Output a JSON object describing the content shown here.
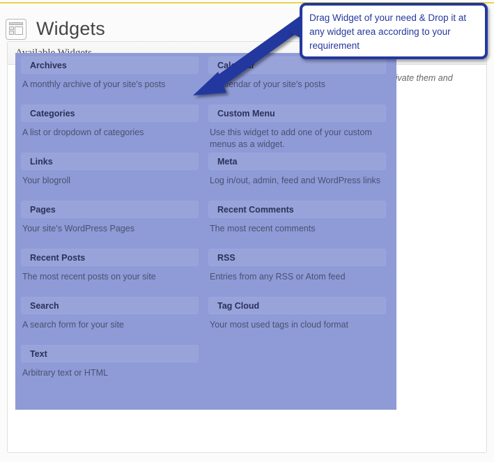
{
  "header": {
    "title": "Widgets",
    "icon": "widgets-layout-icon"
  },
  "panel": {
    "title": "Available Widgets",
    "description": "Drag widgets from here to a sidebar on the right to activate them. Drag widgets back here to deactivate them and delete their settings."
  },
  "callout": {
    "text": "Drag Widget of your need & Drop it at any widget area according to your requirement",
    "border_color": "#23389e",
    "text_color": "#23389e",
    "arrow_color": "#23389e"
  },
  "widget_area": {
    "background_color": "#8e9bd7",
    "left_column": [
      {
        "title": "Archives",
        "description": "A monthly archive of your site’s posts"
      },
      {
        "title": "Categories",
        "description": "A list or dropdown of categories"
      },
      {
        "title": "Links",
        "description": "Your blogroll"
      },
      {
        "title": "Pages",
        "description": "Your site’s WordPress Pages"
      },
      {
        "title": "Recent Posts",
        "description": "The most recent posts on your site"
      },
      {
        "title": "Search",
        "description": "A search form for your site"
      },
      {
        "title": "Text",
        "description": "Arbitrary text or HTML"
      }
    ],
    "right_column": [
      {
        "title": "Calendar",
        "description": "A calendar of your site’s posts"
      },
      {
        "title": "Custom Menu",
        "description": "Use this widget to add one of your custom menus as a widget."
      },
      {
        "title": "Meta",
        "description": "Log in/out, admin, feed and WordPress links"
      },
      {
        "title": "Recent Comments",
        "description": "The most recent comments"
      },
      {
        "title": "RSS",
        "description": "Entries from any RSS or Atom feed"
      },
      {
        "title": "Tag Cloud",
        "description": "Your most used tags in cloud format"
      }
    ]
  }
}
